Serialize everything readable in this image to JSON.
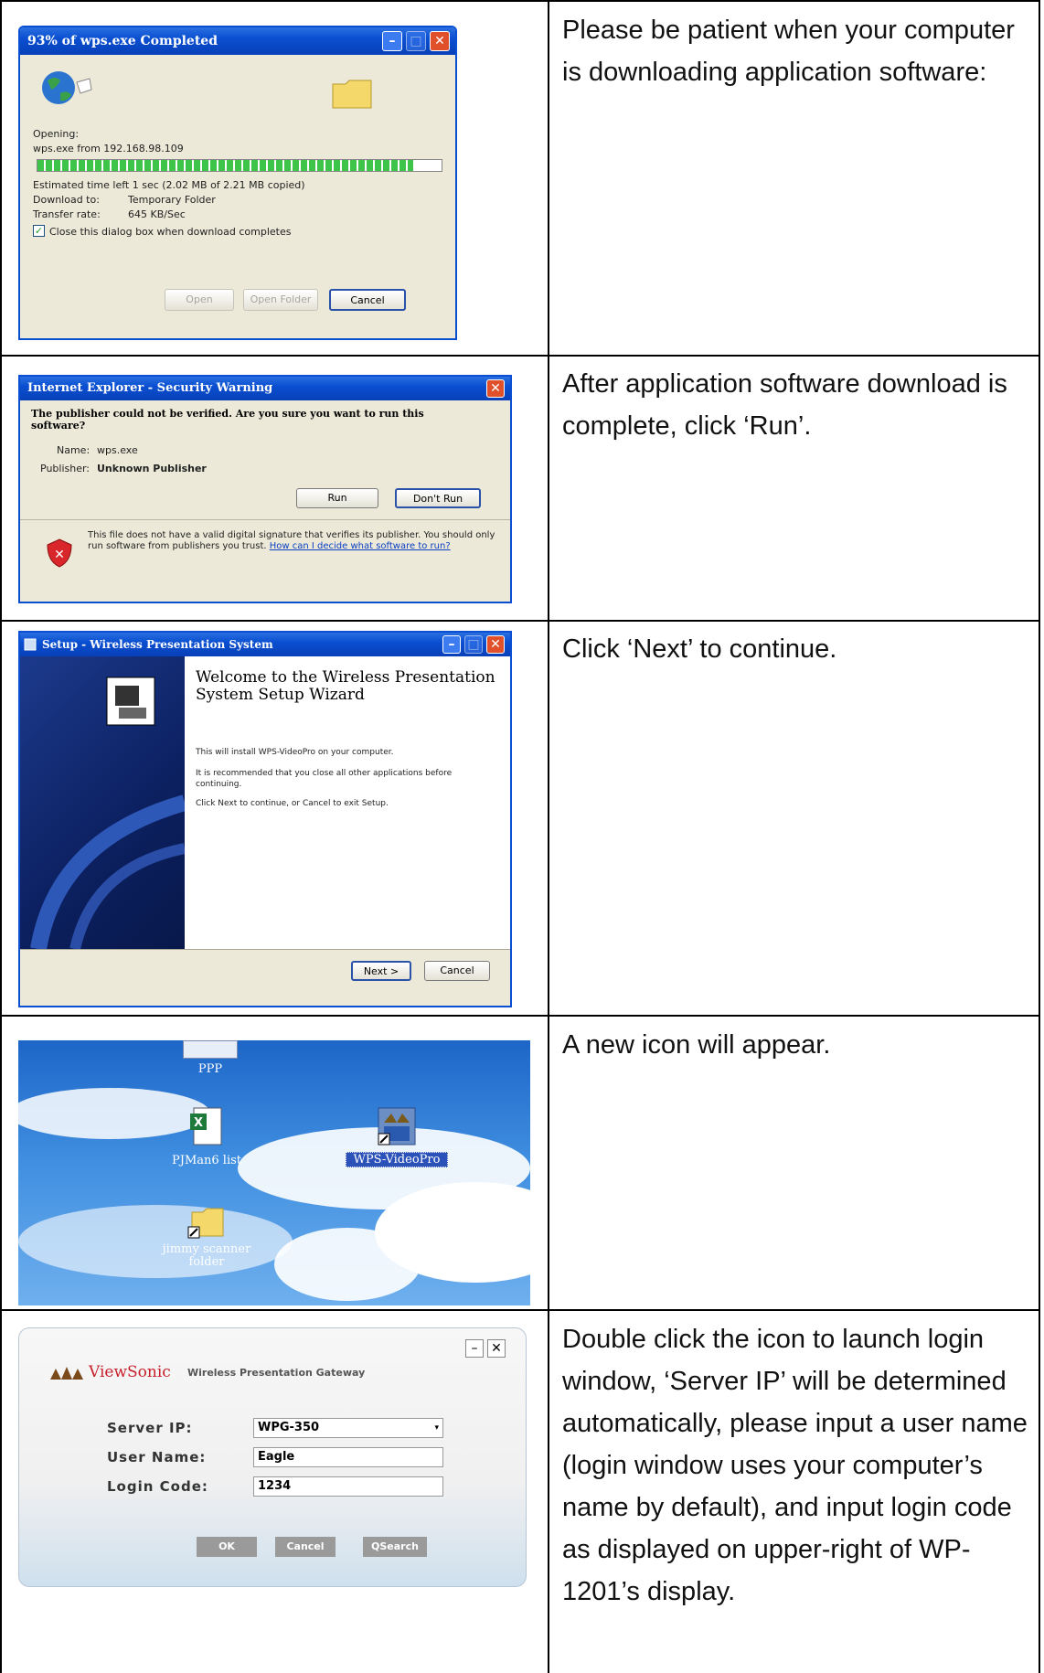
{
  "rows": [
    {
      "description": "Please be patient when your computer is downloading application software:",
      "screenshot": {
        "title": "93% of wps.exe Completed",
        "opening_label": "Opening:",
        "file_line": "wps.exe from 192.168.98.109",
        "progress": 0.93,
        "estimated": "Estimated time left  1 sec (2.02 MB of 2.21 MB copied)",
        "download_to_label": "Download to:",
        "download_to_value": "Temporary Folder",
        "transfer_rate_label": "Transfer rate:",
        "transfer_rate_value": "645 KB/Sec",
        "checkbox_label": "Close this dialog box when download completes",
        "buttons": [
          "Open",
          "Open Folder",
          "Cancel"
        ]
      }
    },
    {
      "description": "After application software download is complete, click ‘Run’.",
      "screenshot": {
        "title": "Internet Explorer - Security Warning",
        "question": "The publisher could not be verified.  Are you sure you want to run this software?",
        "name_label": "Name:",
        "name_value": "wps.exe",
        "publisher_label": "Publisher:",
        "publisher_value": "Unknown Publisher",
        "buttons": [
          "Run",
          "Don't Run"
        ],
        "warning_text": "This file does not have a valid digital signature that verifies its publisher. You should only run software from publishers you trust.",
        "warning_link": "How can I decide what software to run?"
      }
    },
    {
      "description": "Click ‘Next’ to continue.",
      "screenshot": {
        "title": "Setup - Wireless Presentation System",
        "heading": "Welcome to the Wireless Presentation System Setup Wizard",
        "line1": "This will install WPS-VideoPro on your computer.",
        "line2": "It is recommended that you close all other applications before continuing.",
        "line3": "Click Next to continue, or Cancel to exit Setup.",
        "buttons": [
          "Next >",
          "Cancel"
        ]
      }
    },
    {
      "description": "A new icon will appear.",
      "screenshot": {
        "icons": [
          "PPP",
          "PJMan6 list",
          "WPS-VideoPro",
          "jimmy scanner folder"
        ]
      }
    },
    {
      "description": "Double click the icon to launch login window, ‘Server IP’ will be determined automatically, please input a user name (login window uses your computer’s name by default), and input login code as displayed on upper-right of WP-1201’s display.",
      "screenshot": {
        "brand": "ViewSonic",
        "product": "Wireless Presentation Gateway",
        "server_ip_label": "Server IP:",
        "server_ip_value": "WPG-350",
        "user_name_label": "User Name:",
        "user_name_value": "Eagle",
        "login_code_label": "Login Code:",
        "login_code_value": "1234",
        "buttons": [
          "OK",
          "Cancel",
          "Search"
        ]
      }
    }
  ]
}
